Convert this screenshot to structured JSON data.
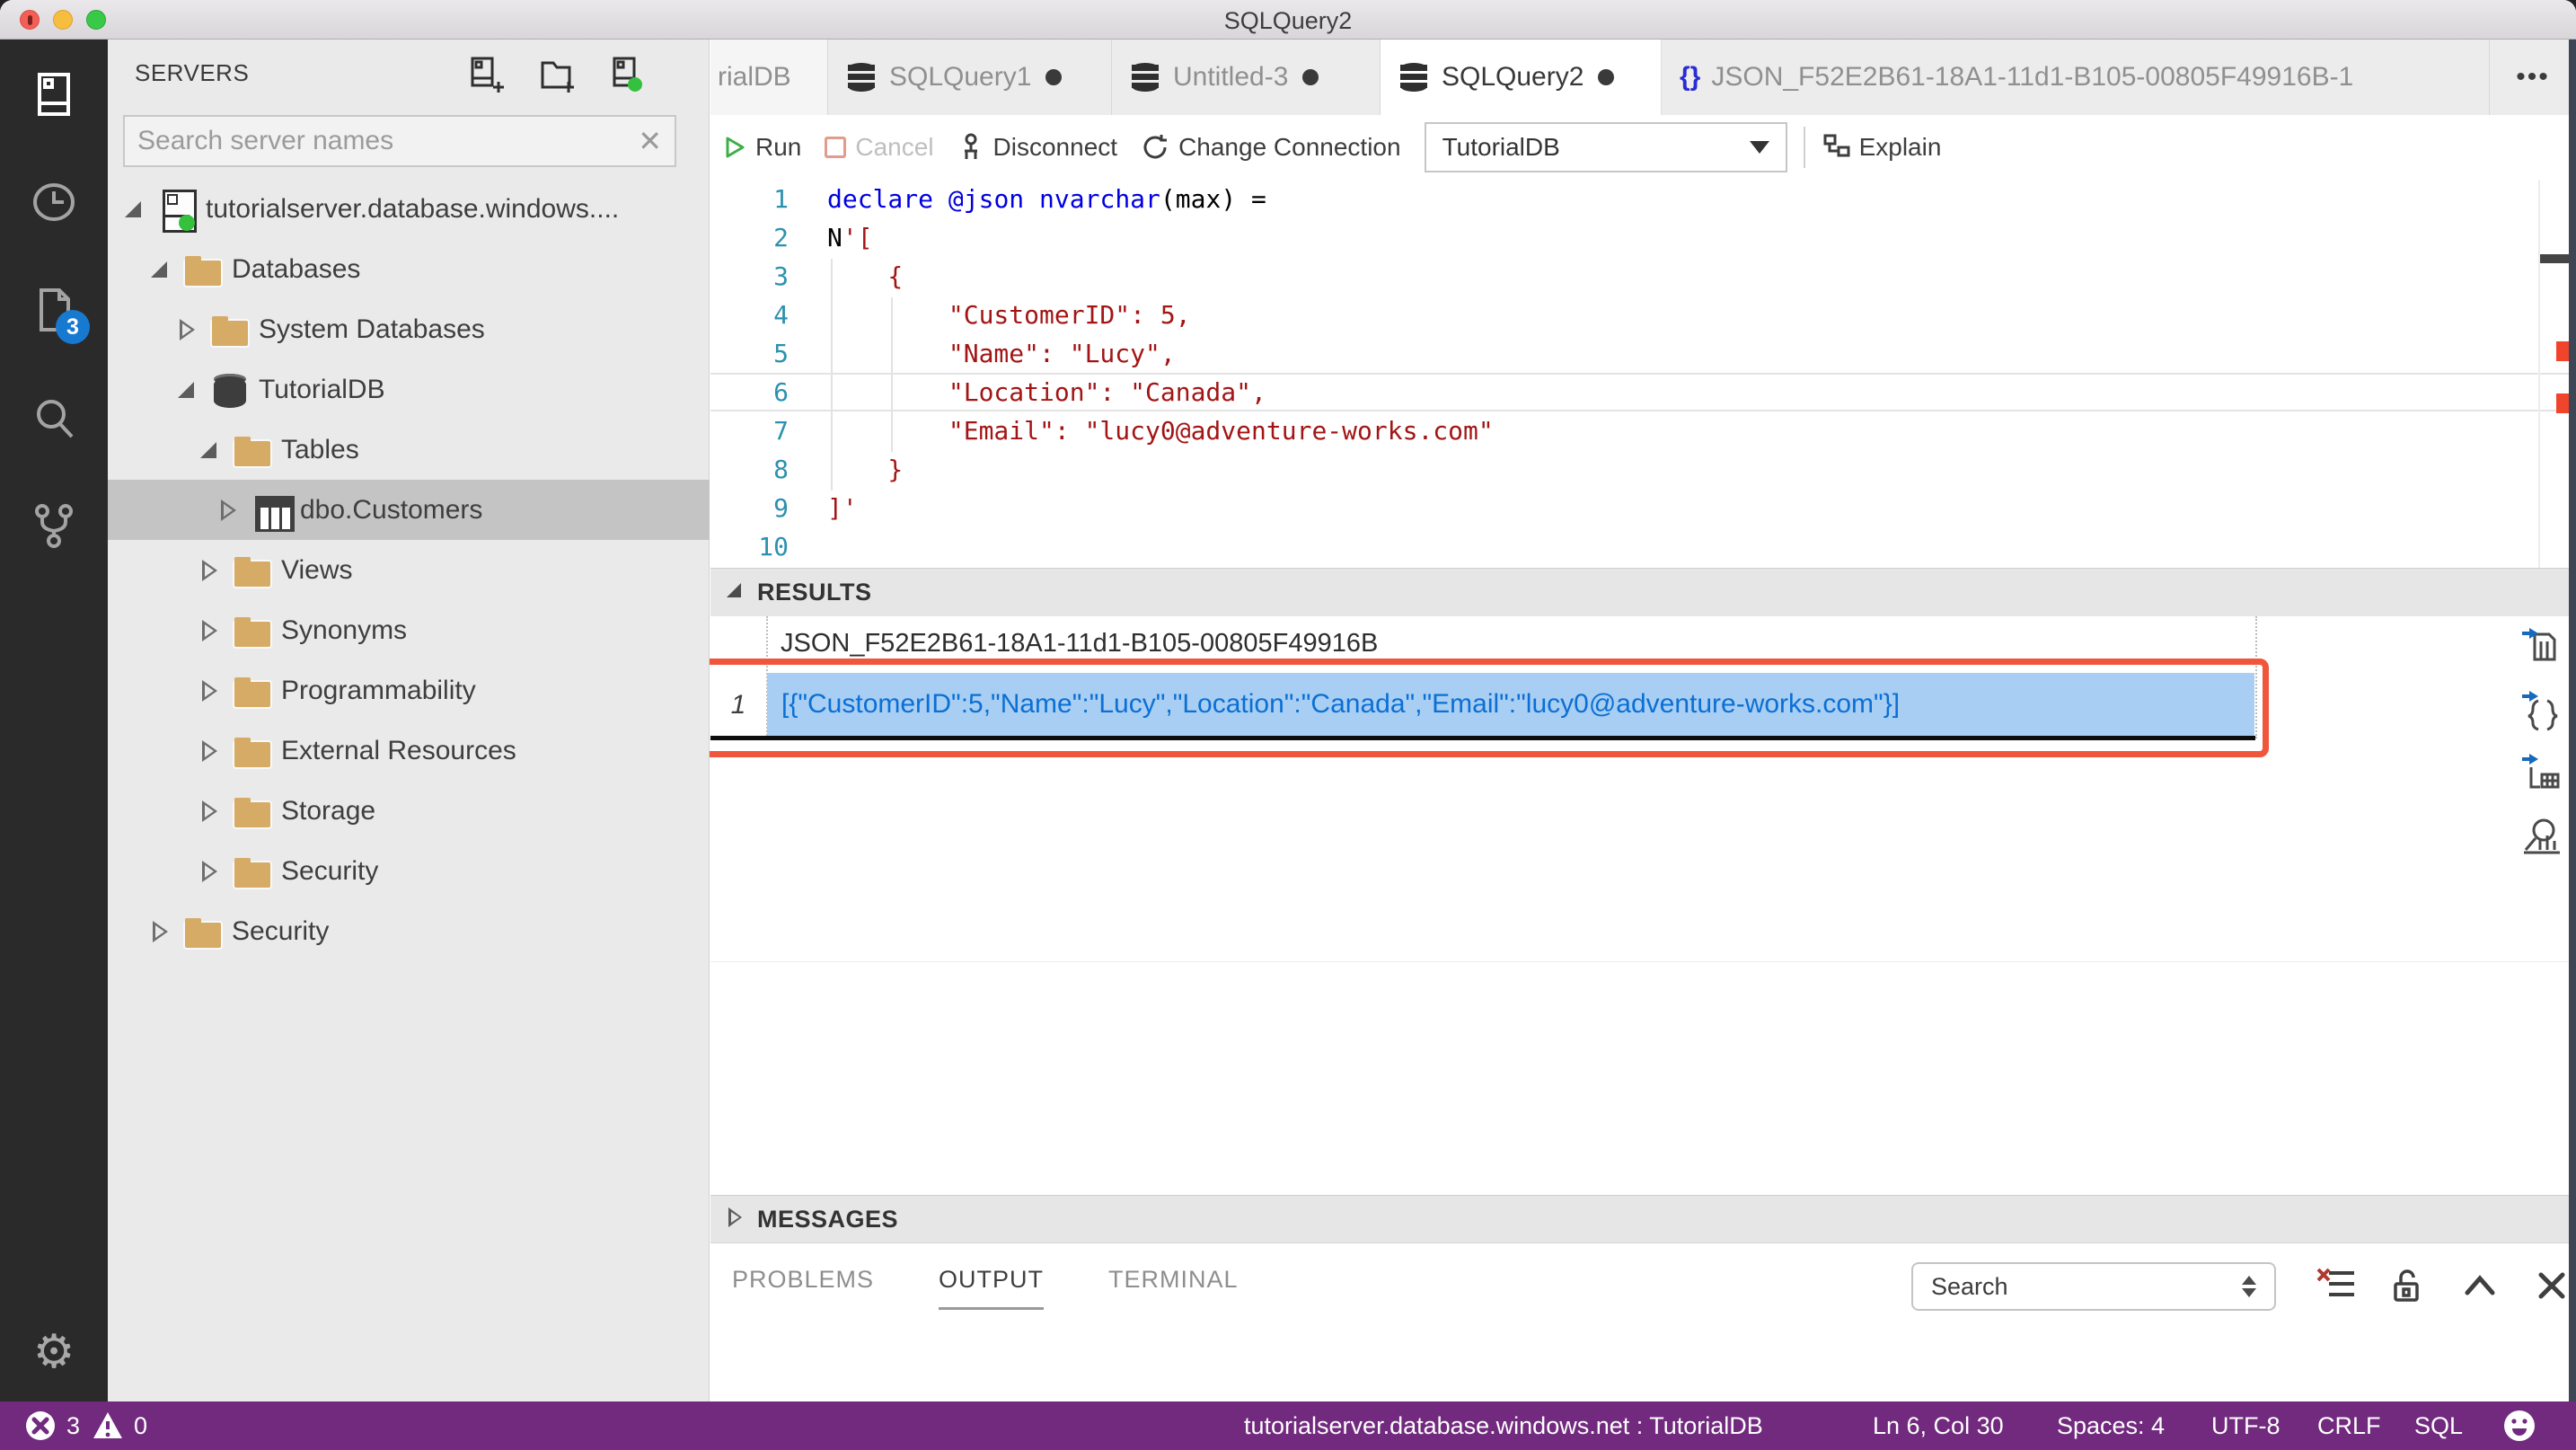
{
  "window": {
    "title": "SQLQuery2"
  },
  "activity_bar": {
    "items": [
      {
        "icon": "servers-icon",
        "active": true
      },
      {
        "icon": "task-history-icon"
      },
      {
        "icon": "open-editors-icon",
        "badge": "3"
      },
      {
        "icon": "search-icon"
      },
      {
        "icon": "source-control-icon"
      }
    ],
    "settings_icon": "⚙"
  },
  "sidebar": {
    "title": "SERVERS",
    "actions": [
      "new-connection",
      "new-server-group",
      "active-connections"
    ],
    "search": {
      "placeholder": "Search server names",
      "clear": "✕"
    },
    "tree": [
      {
        "label": "tutorialserver.database.windows...."
      },
      {
        "label": "Databases"
      },
      {
        "label": "System Databases"
      },
      {
        "label": "TutorialDB"
      },
      {
        "label": "Tables"
      },
      {
        "label": "dbo.Customers"
      },
      {
        "label": "Views"
      },
      {
        "label": "Synonyms"
      },
      {
        "label": "Programmability"
      },
      {
        "label": "External Resources"
      },
      {
        "label": "Storage"
      },
      {
        "label": "Security"
      },
      {
        "label": "Security"
      }
    ]
  },
  "tabs": {
    "items": [
      {
        "label": "rialDB"
      },
      {
        "label": "SQLQuery1"
      },
      {
        "label": "Untitled-3"
      },
      {
        "label": "SQLQuery2"
      },
      {
        "label": "JSON_F52E2B61-18A1-11d1-B105-00805F49916B-1"
      }
    ],
    "more": "•••"
  },
  "toolbar": {
    "run": "Run",
    "cancel": "Cancel",
    "disconnect": "Disconnect",
    "change_connection": "Change Connection",
    "database": "TutorialDB",
    "explain": "Explain"
  },
  "editor": {
    "lines": [
      {
        "num": "1",
        "segments": [
          {
            "t": "declare",
            "c": "kw"
          },
          {
            "t": " ",
            "c": "pl"
          },
          {
            "t": "@json",
            "c": "kw"
          },
          {
            "t": " ",
            "c": "pl"
          },
          {
            "t": "nvarchar",
            "c": "kw"
          },
          {
            "t": "(max) =",
            "c": "pl"
          }
        ]
      },
      {
        "num": "2",
        "segments": [
          {
            "t": "N",
            "c": "pl"
          },
          {
            "t": "'[",
            "c": "str"
          }
        ]
      },
      {
        "num": "3",
        "segments": [
          {
            "t": "    {",
            "c": "str"
          }
        ]
      },
      {
        "num": "4",
        "segments": [
          {
            "t": "        \"CustomerID\": 5,",
            "c": "str"
          }
        ]
      },
      {
        "num": "5",
        "segments": [
          {
            "t": "        \"Name\": \"Lucy\",",
            "c": "str"
          }
        ]
      },
      {
        "num": "6",
        "segments": [
          {
            "t": "        \"Location\": \"Canada\",",
            "c": "str"
          }
        ]
      },
      {
        "num": "7",
        "segments": [
          {
            "t": "        \"Email\": \"lucy0@adventure-works.com\"",
            "c": "str"
          }
        ]
      },
      {
        "num": "8",
        "segments": [
          {
            "t": "    }",
            "c": "str"
          }
        ]
      },
      {
        "num": "9",
        "segments": [
          {
            "t": "]'",
            "c": "str"
          }
        ]
      },
      {
        "num": "10",
        "segments": []
      }
    ],
    "cursor_line": 6
  },
  "results": {
    "header": "RESULTS",
    "column": "JSON_F52E2B61-18A1-11d1-B105-00805F49916B",
    "rows": [
      {
        "num": "1",
        "value": "[{\"CustomerID\":5,\"Name\":\"Lucy\",\"Location\":\"Canada\",\"Email\":\"lucy0@adventure-works.com\"}]"
      }
    ],
    "export_actions": [
      "save-as-csv",
      "save-as-json",
      "save-as-excel",
      "view-as-chart"
    ]
  },
  "messages": {
    "header": "MESSAGES"
  },
  "panel": {
    "tabs": [
      {
        "label": "PROBLEMS"
      },
      {
        "label": "OUTPUT",
        "active": true
      },
      {
        "label": "TERMINAL"
      }
    ],
    "search": {
      "value": "Search"
    },
    "actions": [
      "clear-output",
      "unlock",
      "maximize-panel",
      "close-panel"
    ]
  },
  "status_bar": {
    "errors": "3",
    "warnings": "0",
    "connection": "tutorialserver.database.windows.net : TutorialDB",
    "cursor": "Ln 6, Col 30",
    "spaces": "Spaces: 4",
    "encoding": "UTF-8",
    "eol": "CRLF",
    "language": "SQL"
  },
  "colors": {
    "status_bar_bg": "#712a7e",
    "selection_bg": "#a8cef3",
    "result_link_blue": "#0b6fd4",
    "annotation_orange": "#f0563c",
    "folder_tan": "#d5ab66",
    "keyword_blue": "#0000e0",
    "string_red": "#a31515",
    "line_number_teal": "#2b91af",
    "badge_blue": "#1879d0",
    "run_green": "#3fae49",
    "cancel_salmon": "#e39a8f",
    "error_marker_red": "#f0442c",
    "traffic_red": "#f35f57",
    "traffic_yellow": "#f6bd3e",
    "traffic_green": "#39c948"
  }
}
